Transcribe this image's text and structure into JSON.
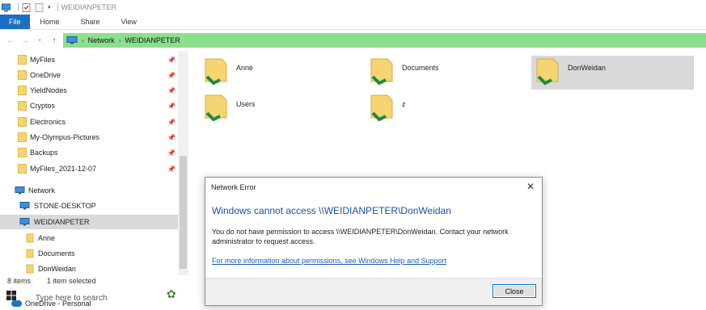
{
  "window": {
    "title": "WEIDIANPETER"
  },
  "ribbon": {
    "tabs": [
      "File",
      "Home",
      "Share",
      "View"
    ]
  },
  "address": {
    "crumbs": [
      "Network",
      "WEIDIANPETER"
    ]
  },
  "nav": {
    "quick_access": [
      {
        "label": "MyFiles",
        "pinned": true
      },
      {
        "label": "OneDrive",
        "pinned": true
      },
      {
        "label": "YieldNodes",
        "pinned": true
      },
      {
        "label": "Cryptos",
        "pinned": true
      },
      {
        "label": "Electronics",
        "pinned": true
      },
      {
        "label": "My-Olympus-Pictures",
        "pinned": true
      },
      {
        "label": "Backups",
        "pinned": true
      },
      {
        "label": "MyFiles_2021-12-07",
        "pinned": true
      }
    ],
    "network_label": "Network",
    "computers": [
      "STONE-DESKTOP",
      "WEIDIANPETER"
    ],
    "shares": [
      "Anne",
      "Documents",
      "DonWeidan"
    ]
  },
  "content": {
    "items": [
      {
        "label": "Anne"
      },
      {
        "label": "Documents"
      },
      {
        "label": "DonWeidan"
      },
      {
        "label": "Users"
      },
      {
        "label": "z"
      }
    ]
  },
  "status": {
    "count": "8 items",
    "selected": "1 item selected"
  },
  "taskbar": {
    "search_placeholder": "Type here to search",
    "onedrive_label": "OneDrive - Personal"
  },
  "dialog": {
    "title": "Network Error",
    "heading": "Windows cannot access \\\\WEIDIANPETER\\DonWeidan",
    "body": "You do not have permission to access \\\\WEIDIANPETER\\DonWeidan. Contact your network administrator to request access.",
    "link": "For more information about permissions, see Windows Help and Support",
    "close_label": "Close",
    "close_glyph": "✕"
  },
  "colors": {
    "accent": "#1a6fc4",
    "address_bar": "#8be08b",
    "selection": "#d9d9d9",
    "dialog_heading": "#1f4ea7"
  }
}
